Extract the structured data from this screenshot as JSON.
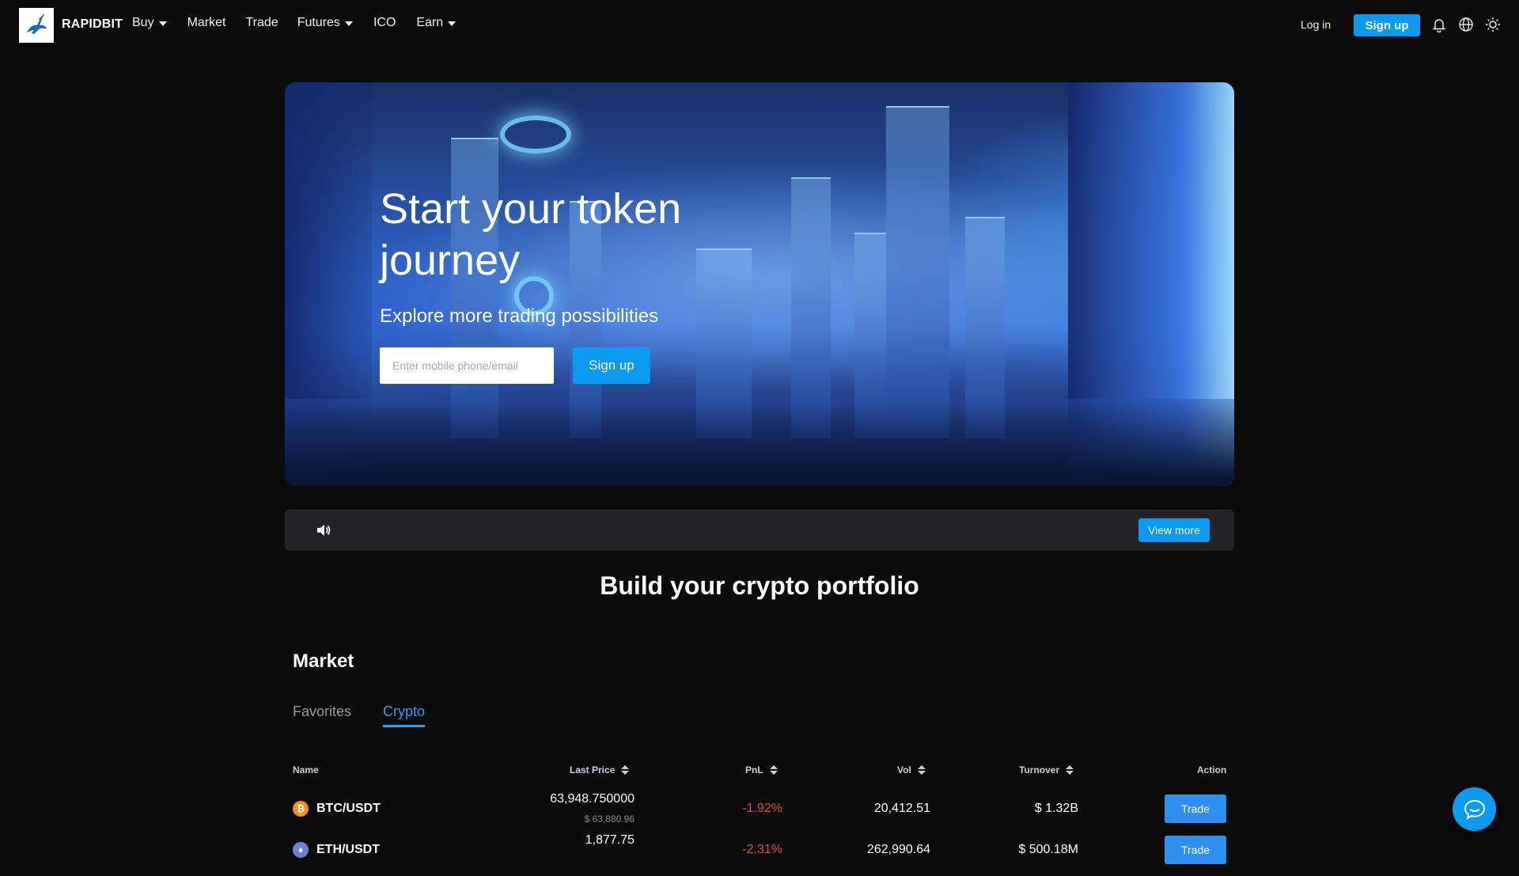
{
  "brand": {
    "name": "RAPIDBIT",
    "logo_icon": "rabbit-logo-icon"
  },
  "nav": [
    {
      "label": "Buy",
      "dropdown": true
    },
    {
      "label": "Market",
      "dropdown": false
    },
    {
      "label": "Trade",
      "dropdown": false
    },
    {
      "label": "Futures",
      "dropdown": true
    },
    {
      "label": "ICO",
      "dropdown": false
    },
    {
      "label": "Earn",
      "dropdown": true
    }
  ],
  "header": {
    "login_label": "Log in",
    "signup_label": "Sign up",
    "icons": [
      "bell-icon",
      "globe-icon",
      "sun-icon"
    ]
  },
  "hero": {
    "title": "Start your token journey",
    "subtitle": "Explore more trading possibilities",
    "input_placeholder": "Enter mobile phone/email",
    "signup_label": "Sign up"
  },
  "announcement": {
    "icon": "speaker-icon",
    "view_more_label": "View more"
  },
  "section_title": "Build your crypto portfolio",
  "market": {
    "title": "Market",
    "tabs": [
      {
        "label": "Favorites",
        "active": false
      },
      {
        "label": "Crypto",
        "active": true
      }
    ],
    "columns": {
      "name": "Name",
      "last_price": "Last Price",
      "pnl": "PnL",
      "vol": "Vol",
      "turnover": "Turnover",
      "action": "Action"
    },
    "rows": [
      {
        "icon": "bitcoin-icon",
        "pair": "BTC/USDT",
        "price": "63,948.750000",
        "price_usd": "$ 63,880.96",
        "pnl": "-1.92%",
        "vol": "20,412.51",
        "turnover": "$ 1.32B",
        "action": "Trade"
      },
      {
        "icon": "ethereum-icon",
        "pair": "ETH/USDT",
        "price": "1,877.75",
        "price_usd": "",
        "pnl": "-2.31%",
        "vol": "262,990.64",
        "turnover": "$ 500.18M",
        "action": "Trade"
      }
    ]
  },
  "colors": {
    "accent": "#0a9bf0",
    "negative": "#e04a4a",
    "background": "#0b0b0c",
    "tab_active": "#2e9cf2"
  }
}
